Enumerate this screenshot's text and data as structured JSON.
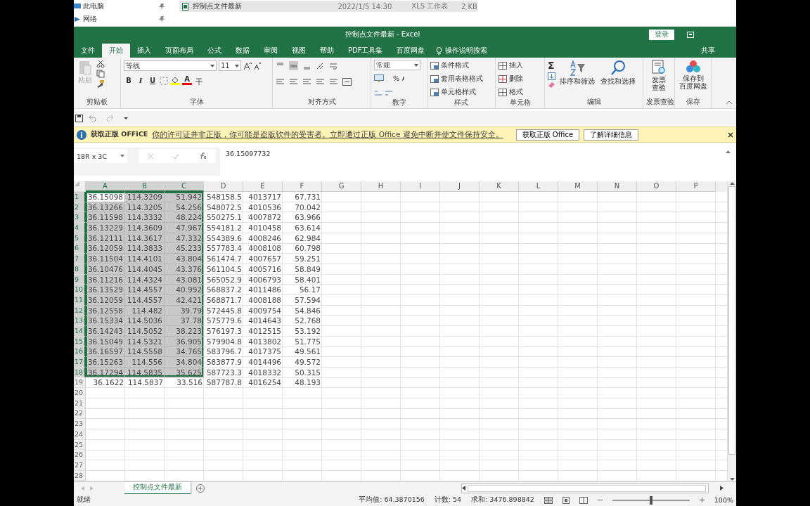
{
  "explorer": {
    "nav_items": [
      {
        "label": "此电脑"
      },
      {
        "label": "网络"
      }
    ],
    "file_row": {
      "name": "控制点文件最新",
      "modified": "2022/1/5 14:30",
      "type": "XLS 工作表",
      "size": "2 KB"
    }
  },
  "window": {
    "title": "控制点文件最新  -  Excel",
    "sign_in": "登录"
  },
  "tabs": [
    {
      "label": "文件",
      "selected": false
    },
    {
      "label": "开始",
      "selected": true
    },
    {
      "label": "插入",
      "selected": false
    },
    {
      "label": "页面布局",
      "selected": false
    },
    {
      "label": "公式",
      "selected": false
    },
    {
      "label": "数据",
      "selected": false
    },
    {
      "label": "审阅",
      "selected": false
    },
    {
      "label": "视图",
      "selected": false
    },
    {
      "label": "帮助",
      "selected": false
    },
    {
      "label": "PDF工具集",
      "selected": false
    },
    {
      "label": "百度网盘",
      "selected": false
    }
  ],
  "tell_me": "操作说明搜索",
  "share": "共享",
  "ribbon": {
    "clipboard": {
      "label": "剪贴板",
      "paste": "粘贴",
      "disabled": true
    },
    "font": {
      "label": "字体",
      "font_name": "等线",
      "font_size": "11",
      "bold": "B",
      "italic": "I",
      "underline": "U",
      "font_color": "A"
    },
    "alignment": {
      "label": "对齐方式"
    },
    "number": {
      "label": "数字",
      "format": "常规",
      "percent": "%"
    },
    "styles": {
      "label": "样式",
      "items": [
        "条件格式",
        "套用表格格式",
        "单元格样式"
      ]
    },
    "cells": {
      "label": "单元格",
      "items": [
        "插入",
        "删除",
        "格式"
      ]
    },
    "editing": {
      "label": "编辑",
      "sum": "Σ",
      "sort": "排序和筛选",
      "find": "查找和选择"
    },
    "invoice": {
      "label": "发票查验",
      "button": [
        "发票",
        "查验"
      ]
    },
    "save": {
      "label": "保存",
      "button": [
        "保存到",
        "百度网盘"
      ]
    }
  },
  "info_bar": {
    "title": "获取正版 OFFICE",
    "message": "你的许可证并非正版，你可能是盗版软件的受害者。立即通过正版 Office 避免中断并使文件保持安全。",
    "buttons": [
      "获取正版 Office",
      "了解详细信息"
    ]
  },
  "formula_bar": {
    "name_box": "18R x 3C",
    "value": "36.15097732"
  },
  "grid": {
    "columns": [
      {
        "label": "A",
        "selected": true
      },
      {
        "label": "B",
        "selected": true
      },
      {
        "label": "C",
        "selected": true
      },
      {
        "label": "D",
        "selected": false
      },
      {
        "label": "E",
        "selected": false
      },
      {
        "label": "F",
        "selected": false
      },
      {
        "label": "G",
        "selected": false
      },
      {
        "label": "H",
        "selected": false
      },
      {
        "label": "I",
        "selected": false
      },
      {
        "label": "J",
        "selected": false
      },
      {
        "label": "K",
        "selected": false
      },
      {
        "label": "L",
        "selected": false
      },
      {
        "label": "M",
        "selected": false
      },
      {
        "label": "N",
        "selected": false
      },
      {
        "label": "O",
        "selected": false
      },
      {
        "label": "P",
        "selected": false
      }
    ],
    "rows": [
      {
        "label": "1",
        "selected": true,
        "cells": [
          "36.15098",
          "114.3209",
          "51.942",
          "548158.5",
          "4013717",
          "67.731"
        ]
      },
      {
        "label": "2",
        "selected": true,
        "cells": [
          "36.13266",
          "114.3205",
          "54.256",
          "548072.5",
          "4010536",
          "70.042"
        ]
      },
      {
        "label": "3",
        "selected": true,
        "cells": [
          "36.11598",
          "114.3332",
          "48.224",
          "550275.1",
          "4007872",
          "63.966"
        ]
      },
      {
        "label": "4",
        "selected": true,
        "cells": [
          "36.13229",
          "114.3609",
          "47.967",
          "554181.2",
          "4010458",
          "63.614"
        ]
      },
      {
        "label": "5",
        "selected": true,
        "cells": [
          "36.12111",
          "114.3617",
          "47.332",
          "554389.6",
          "4008246",
          "62.984"
        ]
      },
      {
        "label": "6",
        "selected": true,
        "cells": [
          "36.12059",
          "114.3833",
          "45.233",
          "557783.4",
          "4008108",
          "60.798"
        ]
      },
      {
        "label": "7",
        "selected": true,
        "cells": [
          "36.11504",
          "114.4101",
          "43.804",
          "561474.7",
          "4007657",
          "59.251"
        ]
      },
      {
        "label": "8",
        "selected": true,
        "cells": [
          "36.10476",
          "114.4045",
          "43.376",
          "561104.5",
          "4005716",
          "58.849"
        ]
      },
      {
        "label": "9",
        "selected": true,
        "cells": [
          "36.11216",
          "114.4324",
          "43.081",
          "565052.9",
          "4006793",
          "58.401"
        ]
      },
      {
        "label": "10",
        "selected": true,
        "cells": [
          "36.13529",
          "114.4557",
          "40.992",
          "568837.2",
          "4011486",
          "56.17"
        ]
      },
      {
        "label": "11",
        "selected": true,
        "cells": [
          "36.12059",
          "114.4557",
          "42.421",
          "568871.7",
          "4008188",
          "57.594"
        ]
      },
      {
        "label": "12",
        "selected": true,
        "cells": [
          "36.12558",
          "114.482",
          "39.79",
          "572445.8",
          "4009754",
          "54.846"
        ]
      },
      {
        "label": "13",
        "selected": true,
        "cells": [
          "36.15334",
          "114.5036",
          "37.78",
          "575779.6",
          "4014643",
          "52.768"
        ]
      },
      {
        "label": "14",
        "selected": true,
        "cells": [
          "36.14243",
          "114.5052",
          "38.223",
          "576197.3",
          "4012515",
          "53.192"
        ]
      },
      {
        "label": "15",
        "selected": true,
        "cells": [
          "36.15049",
          "114.5321",
          "36.905",
          "579904.8",
          "4013802",
          "51.775"
        ]
      },
      {
        "label": "16",
        "selected": true,
        "cells": [
          "36.16597",
          "114.5558",
          "34.765",
          "583796.7",
          "4017375",
          "49.561"
        ]
      },
      {
        "label": "17",
        "selected": true,
        "cells": [
          "36.15263",
          "114.556",
          "34.804",
          "583877.9",
          "4014496",
          "49.572"
        ]
      },
      {
        "label": "18",
        "selected": true,
        "cells": [
          "36.17294",
          "114.5835",
          "35.625",
          "587723.3",
          "4018332",
          "50.315"
        ]
      },
      {
        "label": "19",
        "selected": false,
        "cells": [
          "36.1622",
          "114.5837",
          "33.516",
          "587787.8",
          "4016254",
          "48.193"
        ]
      },
      {
        "label": "20",
        "selected": false
      },
      {
        "label": "21",
        "selected": false
      },
      {
        "label": "22",
        "selected": false
      },
      {
        "label": "23",
        "selected": false
      },
      {
        "label": "24",
        "selected": false
      },
      {
        "label": "25",
        "selected": false
      },
      {
        "label": "26",
        "selected": false
      },
      {
        "label": "27",
        "selected": false
      },
      {
        "label": "28",
        "selected": false
      }
    ]
  },
  "sheet_tabs": [
    {
      "label": "控制点文件最新",
      "selected": true
    }
  ],
  "status_bar": {
    "mode": "就绪",
    "average": "平均值: 64.3870156",
    "count": "计数: 54",
    "sum": "求和: 3476.898842",
    "zoom": "100%",
    "zoom_level": {
      "level": 0.5
    }
  }
}
